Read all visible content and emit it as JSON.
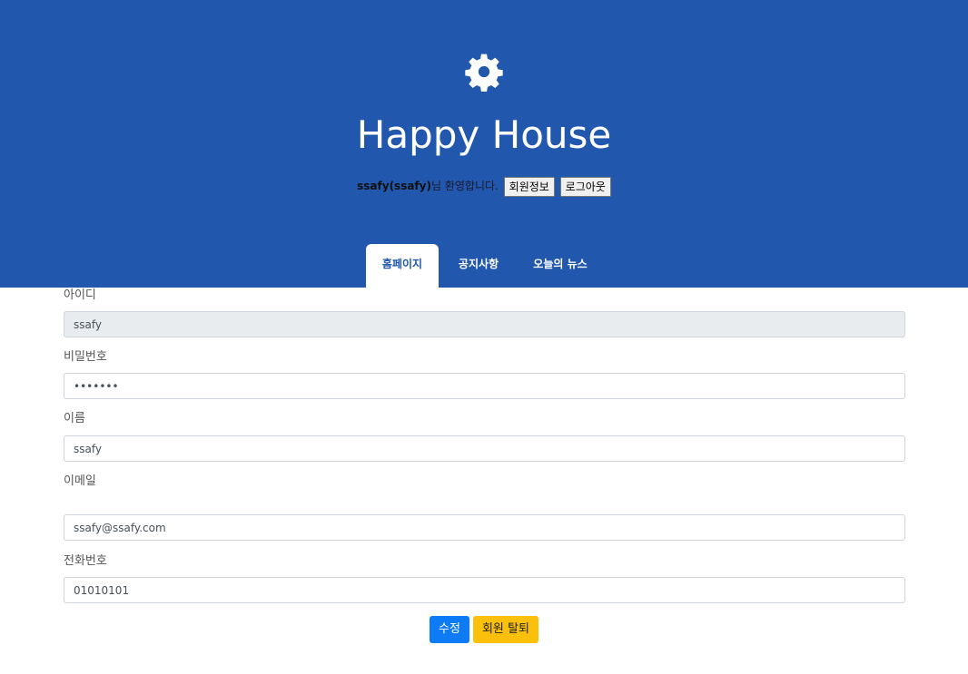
{
  "header": {
    "icon": "gear-icon",
    "title": "Happy House",
    "welcome_user": "ssafy(ssafy)",
    "welcome_msg": "님 환영합니다.",
    "member_info_label": "회원정보",
    "logout_label": "로그아웃",
    "bg_color": "#2157ad"
  },
  "tabs": [
    {
      "label": "홈페이지",
      "active": true
    },
    {
      "label": "공지사항",
      "active": false
    },
    {
      "label": "오늘의 뉴스",
      "active": false
    }
  ],
  "form": {
    "id_label": "아이디",
    "id_value": "ssafy",
    "password_label": "비밀번호",
    "password_value": "•••••••",
    "name_label": "이름",
    "name_value": "ssafy",
    "email_label": "이메일",
    "email_value": "ssafy@ssafy.com",
    "phone_label": "전화번호",
    "phone_value": "01010101"
  },
  "actions": {
    "edit_label": "수정",
    "withdraw_label": "회원 탈퇴"
  }
}
